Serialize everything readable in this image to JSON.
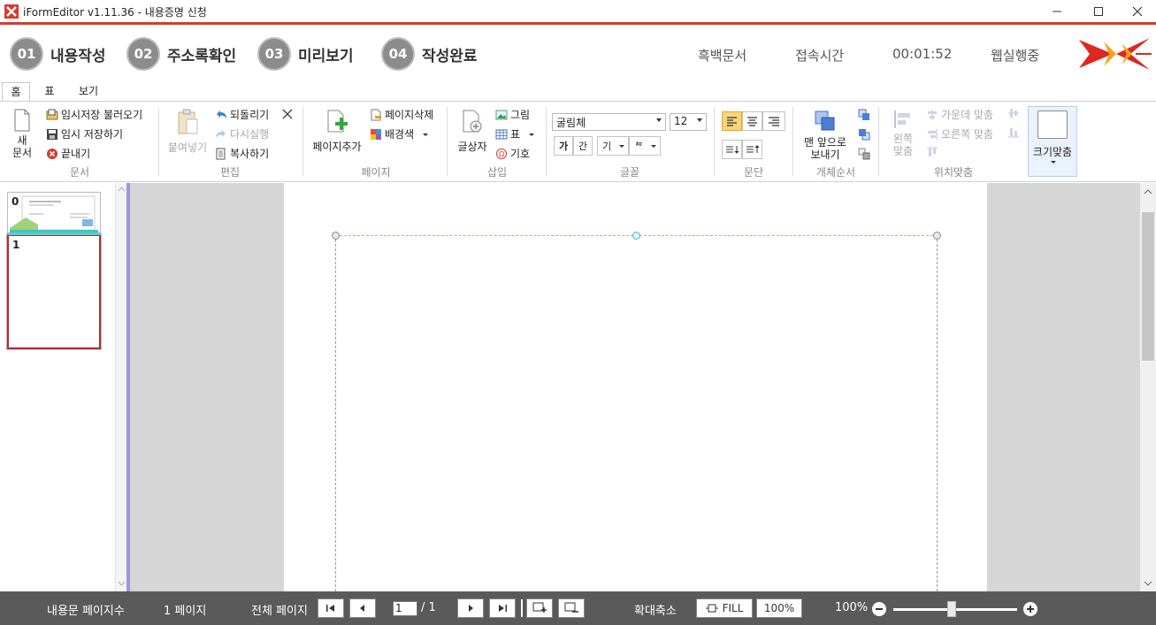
{
  "window": {
    "title": "iFormEditor v1.11.36 - 내용증명 신청",
    "minimize_icon": "minimize-icon",
    "maximize_icon": "maximize-icon",
    "close_icon": "close-icon"
  },
  "steps": [
    {
      "num": "01",
      "label": "내용작성"
    },
    {
      "num": "02",
      "label": "주소록확인"
    },
    {
      "num": "03",
      "label": "미리보기"
    },
    {
      "num": "04",
      "label": "작성완료"
    }
  ],
  "header_info": {
    "doc_type": "흑백문서",
    "access_label": "접속시간",
    "access_time": "00:01:52",
    "web_status": "웹실행중"
  },
  "tabs": [
    "홈",
    "표",
    "보기"
  ],
  "ribbon": {
    "document": {
      "new_label_1": "새",
      "new_label_2": "문서",
      "load_temp": "임시저장 불러오기",
      "save_temp": "임시 저장하기",
      "exit": "끝내기",
      "group": "문서"
    },
    "edit": {
      "paste": "붙여넣기",
      "undo": "되돌리기",
      "redo": "다시실행",
      "copy": "복사하기",
      "group": "편집"
    },
    "page": {
      "add_page": "페이지추가",
      "delete_page": "페이지삭제",
      "bg_color": "배경색",
      "group": "페이지"
    },
    "insert": {
      "textbox": "글상자",
      "picture": "그림",
      "table": "표",
      "symbol": "기호",
      "group": "삽입"
    },
    "font": {
      "family": "굴림체",
      "size": "12",
      "bold_glyph": "가",
      "italic_glyph": "간",
      "color_glyph": "기",
      "highlight_glyph": "ᅍ",
      "group": "글꼴"
    },
    "paragraph": {
      "group": "문단"
    },
    "order": {
      "bring_front_1": "맨 앞으로",
      "bring_front_2": "보내기",
      "group": "개체순서"
    },
    "position": {
      "left_1": "왼쪽",
      "left_2": "맞춤",
      "center": "가운데 맞춤",
      "right": "오른쪽 맞춤",
      "group": "위치맞춤"
    },
    "fit": {
      "label": "크기맞춤"
    }
  },
  "thumbnails": [
    {
      "num": "0"
    },
    {
      "num": "1"
    }
  ],
  "status": {
    "content_pages_label": "내용문 페이지수",
    "content_pages_value": "1 페이지",
    "total_pages_label": "전체 페이지",
    "page_current": "1",
    "page_total": "/ 1",
    "zoom_label": "확대축소",
    "fill_btn": "FILL",
    "pct_btn": "100%",
    "zoom_value": "100%",
    "zoom_level": 0.47
  },
  "colors": {
    "accent_red": "#d93a2b",
    "status_bg": "#5a5a5a",
    "align_active": "#fbd57a",
    "thumb_selected": "#c0262d"
  }
}
